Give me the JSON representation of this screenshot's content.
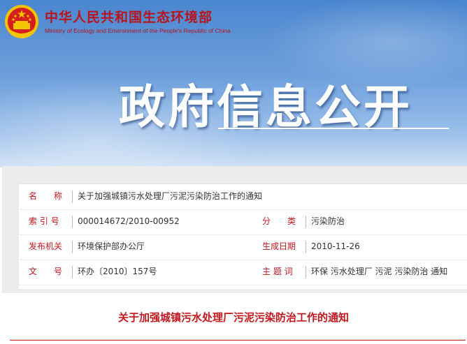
{
  "site": {
    "name_cn": "中华人民共和国生态环境部",
    "name_en": "Ministry of Ecology and Environment of the People's Republic of China"
  },
  "banner": {
    "title": "政府信息公开"
  },
  "colors": {
    "brand_red": "#c4161c",
    "banner_blue": "#4a86cf",
    "emblem_gold": "#f5c400"
  },
  "info": {
    "name": {
      "label": "名　　称",
      "value": "关于加强城镇污水处理厂污泥污染防治工作的通知"
    },
    "index": {
      "label": "索 引 号",
      "value": "000014672/2010-00952"
    },
    "category": {
      "label": "分　　类",
      "value": "污染防治"
    },
    "issuer": {
      "label": "发布机关",
      "value": "环境保护部办公厅"
    },
    "date": {
      "label": "生成日期",
      "value": "2010-11-26"
    },
    "doc_no": {
      "label": "文　　号",
      "value": "环办〔2010〕157号"
    },
    "keywords": {
      "label": "主 题 词",
      "value": "环保 污水处理厂 污泥 污染防治 通知"
    }
  },
  "document": {
    "title": "关于加强城镇污水处理厂污泥污染防治工作的通知"
  }
}
